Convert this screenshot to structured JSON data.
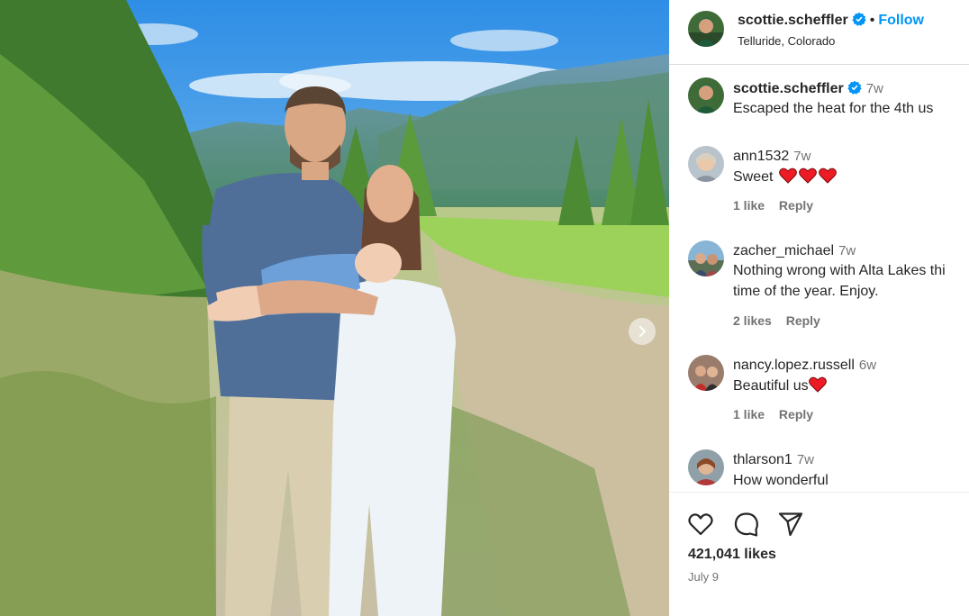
{
  "post": {
    "username": "scottie.scheffler",
    "follow_label": "Follow",
    "location": "Telluride, Colorado",
    "caption": {
      "username": "scottie.scheffler",
      "time": "7w",
      "text": "Escaped the heat for the 4th us"
    },
    "likes": "421,041 likes",
    "date": "July 9"
  },
  "comments": [
    {
      "username": "ann1532",
      "time": "7w",
      "text": "Sweet",
      "hearts": 3,
      "likes": "1 like",
      "reply": "Reply"
    },
    {
      "username": "zacher_michael",
      "time": "7w",
      "text_line1": "Nothing wrong with Alta Lakes thi",
      "text_line2": "time of the year. Enjoy.",
      "likes": "2 likes",
      "reply": "Reply"
    },
    {
      "username": "nancy.lopez.russell",
      "time": "6w",
      "text": "Beautiful us",
      "hearts": 1,
      "likes": "1 like",
      "reply": "Reply"
    },
    {
      "username": "thlarson1",
      "time": "7w",
      "text": "How wonderful"
    }
  ],
  "icons": {
    "verified": "verified-badge-icon",
    "like": "heart-outline-icon",
    "comment": "comment-bubble-icon",
    "share": "paper-plane-icon",
    "carousel_next": "chevron-right-icon"
  },
  "colors": {
    "accent": "#0095f6",
    "heart": "#ed1c24",
    "muted": "#737373"
  }
}
